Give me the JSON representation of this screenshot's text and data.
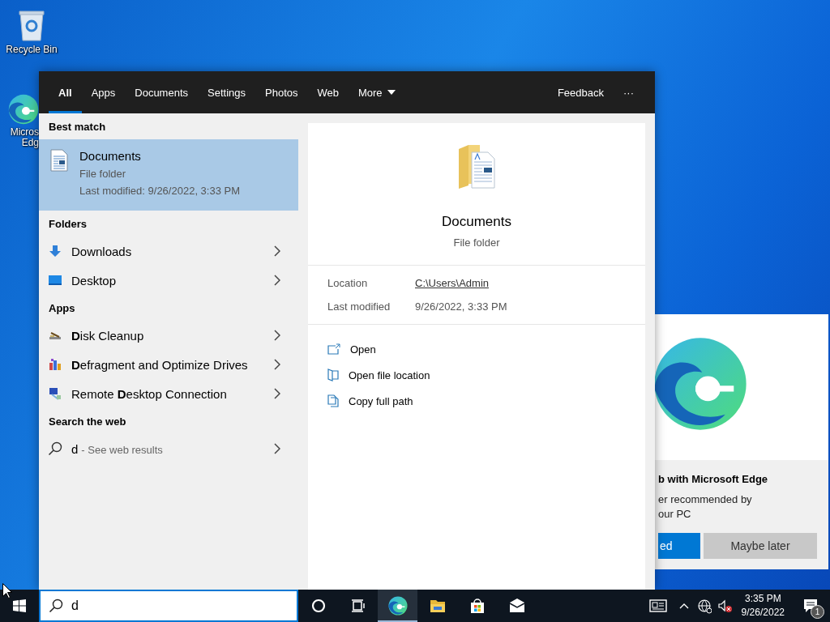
{
  "desktop_icons": [
    {
      "label_lines": [
        "Recycle Bin"
      ]
    },
    {
      "label_lines": [
        "Micros",
        "Edg"
      ]
    }
  ],
  "search_panel": {
    "tabs": [
      {
        "label": "All",
        "selected": true,
        "dropdown": false
      },
      {
        "label": "Apps",
        "selected": false,
        "dropdown": false
      },
      {
        "label": "Documents",
        "selected": false,
        "dropdown": false
      },
      {
        "label": "Settings",
        "selected": false,
        "dropdown": false
      },
      {
        "label": "Photos",
        "selected": false,
        "dropdown": false
      },
      {
        "label": "Web",
        "selected": false,
        "dropdown": false
      },
      {
        "label": "More",
        "selected": false,
        "dropdown": true
      }
    ],
    "feedback": "Feedback",
    "more_options": "···",
    "sections": [
      {
        "heading": "Best match",
        "items": [
          {
            "kind": "best",
            "title": "Documents",
            "subtitle": "File folder",
            "detail": "Last modified: 9/26/2022, 3:33 PM",
            "selected": true
          }
        ]
      },
      {
        "heading": "Folders",
        "items": [
          {
            "kind": "row",
            "title": "Downloads",
            "selected": false
          },
          {
            "kind": "row",
            "title": "Desktop",
            "selected": false
          }
        ]
      },
      {
        "heading": "Apps",
        "items": [
          {
            "kind": "row",
            "title": "**D**isk Cleanup",
            "selected": false
          },
          {
            "kind": "row",
            "title": "**D**efragment and Optimize Drives",
            "selected": false
          },
          {
            "kind": "row",
            "title": "Remote **D**esktop Connection",
            "selected": false
          }
        ]
      },
      {
        "heading": "Search the web",
        "items": [
          {
            "kind": "web",
            "title": "d",
            "hint": "- See web results",
            "selected": false
          }
        ]
      }
    ],
    "preview": {
      "title": "Documents",
      "subtitle": "File folder",
      "properties": [
        {
          "label": "Location",
          "value": "C:\\Users\\Admin",
          "kind": "link"
        },
        {
          "label": "Last modified",
          "value": "9/26/2022, 3:33 PM",
          "kind": "text"
        }
      ],
      "actions": [
        {
          "label": "Open"
        },
        {
          "label": "Open file location"
        },
        {
          "label": "Copy full path"
        }
      ]
    }
  },
  "edge_popup": {
    "heading": "b with Microsoft Edge",
    "body_lines": [
      "er recommended by",
      "our PC"
    ],
    "buttons": [
      {
        "label": "ed",
        "kind": "primary"
      },
      {
        "label": "Maybe later",
        "kind": "secondary"
      }
    ]
  },
  "taskbar": {
    "search": {
      "value": "d"
    },
    "buttons": [
      {
        "running": false
      },
      {
        "running": false
      },
      {
        "running": true
      },
      {
        "running": false
      },
      {
        "running": false
      },
      {
        "running": false
      }
    ],
    "clock": {
      "time": "3:35 PM",
      "date": "9/26/2022"
    },
    "notifications": {
      "badge": "1"
    }
  }
}
